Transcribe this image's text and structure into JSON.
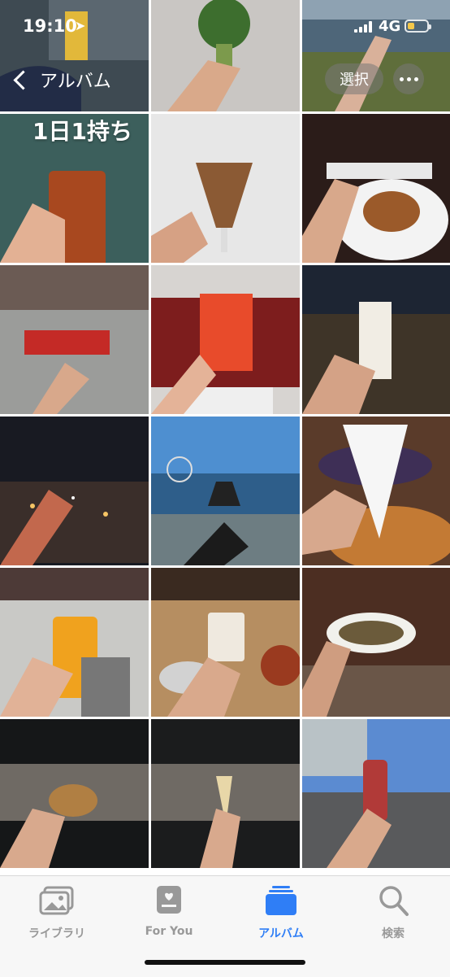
{
  "status": {
    "time": "19:10",
    "network": "4G"
  },
  "nav": {
    "back_label": "アルバム",
    "select_label": "選択"
  },
  "album": {
    "title": "1日1持ち"
  },
  "tabs": [
    {
      "label": "ライブラリ",
      "active": false
    },
    {
      "label": "For You",
      "active": false
    },
    {
      "label": "アルバム",
      "active": true
    },
    {
      "label": "検索",
      "active": false
    }
  ],
  "colors": {
    "accent": "#2f7ef6",
    "inactive": "#999999"
  }
}
